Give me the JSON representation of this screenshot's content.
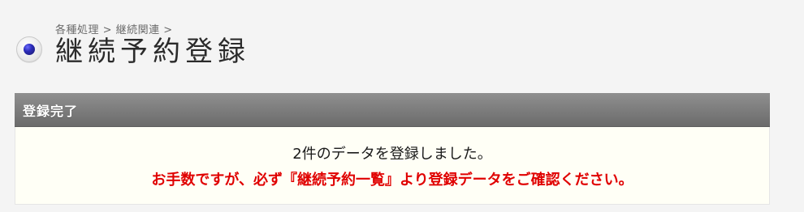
{
  "header": {
    "breadcrumb": "各種処理 > 継続関連 >",
    "title": "継続予約登録",
    "bullet_icon": "radio-bullet-icon"
  },
  "result_panel": {
    "title": "登録完了",
    "message_line1": "2件のデータを登録しました。",
    "message_line2": "お手数ですが、必ず『継続予約一覧』より登録データをご確認ください。"
  },
  "colors": {
    "page_background": "#f4f4f4",
    "panel_header_gradient_top": "#8f8f8f",
    "panel_header_gradient_bottom": "#6b6b6b",
    "panel_body_background": "#fffff6",
    "warning_text": "#e00000"
  }
}
